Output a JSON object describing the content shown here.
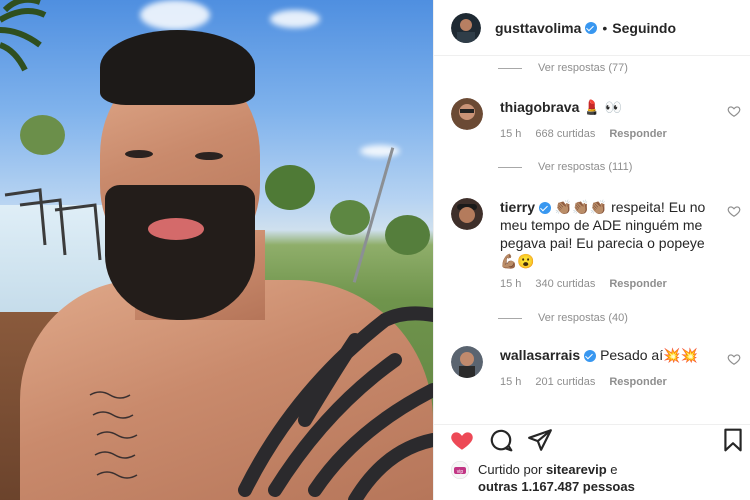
{
  "post": {
    "author": "gusttavolima",
    "follow_status": "Seguindo",
    "separator": "•"
  },
  "comments": {
    "top_replies": "Ver respostas (77)",
    "items": [
      {
        "username": "thiagobrava",
        "text": "💄 👀",
        "verified": false,
        "time": "15 h",
        "likes": "668 curtidas",
        "reply": "Responder",
        "replies": "Ver respostas (111)"
      },
      {
        "username": "tierry",
        "text": "👏🏽👏🏽👏🏽 respeita! Eu no meu tempo de ADE ninguém me pegava pai! Eu parecia o popeye 💪🏽😮",
        "verified": true,
        "time": "15 h",
        "likes": "340 curtidas",
        "reply": "Responder",
        "replies": "Ver respostas (40)"
      },
      {
        "username": "wallasarrais",
        "text": "Pesado aí💥💥",
        "verified": true,
        "time": "15 h",
        "likes": "201 curtidas",
        "reply": "Responder"
      }
    ]
  },
  "likes": {
    "prefix": "Curtido por",
    "user": "sitearevip",
    "conj": "e",
    "others": "outras 1.167.487 pessoas"
  },
  "icons": {
    "like": "heart-filled-icon",
    "comment": "comment-bubble-icon",
    "share": "paper-plane-icon",
    "save": "bookmark-icon",
    "comment_like": "heart-outline-icon"
  },
  "colors": {
    "like_red": "#ed4956",
    "verified_blue": "#3897f0",
    "muted_text": "#8e8e8e"
  }
}
